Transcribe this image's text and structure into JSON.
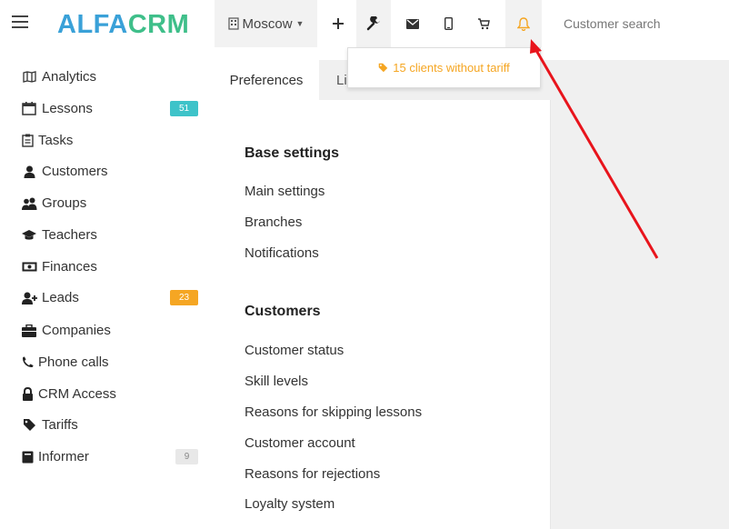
{
  "header": {
    "logo_part1": "ALFA",
    "logo_part2": "CRM",
    "branch": "Moscow",
    "search_placeholder": "Customer search"
  },
  "sidebar": {
    "items": [
      {
        "label": "Analytics",
        "icon": "map-icon"
      },
      {
        "label": "Lessons",
        "icon": "calendar-icon",
        "badge": "51",
        "badge_color": "#3ec3c9"
      },
      {
        "label": "Tasks",
        "icon": "clipboard-icon"
      },
      {
        "label": "Customers",
        "icon": "user-icon"
      },
      {
        "label": "Groups",
        "icon": "users-icon"
      },
      {
        "label": "Teachers",
        "icon": "graduation-cap-icon"
      },
      {
        "label": "Finances",
        "icon": "money-icon"
      },
      {
        "label": "Leads",
        "icon": "user-plus-icon",
        "badge": "23",
        "badge_color": "#f5a623"
      },
      {
        "label": "Companies",
        "icon": "briefcase-icon"
      },
      {
        "label": "Phone calls",
        "icon": "phone-icon"
      },
      {
        "label": "CRM Access",
        "icon": "lock-icon"
      },
      {
        "label": "Tariffs",
        "icon": "tag-icon"
      },
      {
        "label": "Informer",
        "icon": "book-icon",
        "badge": "9",
        "badge_color": "#e8e8e8"
      }
    ]
  },
  "tabs": {
    "active": "Preferences",
    "second": "Li"
  },
  "notification": {
    "text": "15 clients without tariff",
    "color": "#f5a623"
  },
  "settings": {
    "base_title": "Base settings",
    "base_links": [
      "Main settings",
      "Branches",
      "Notifications"
    ],
    "customers_title": "Customers",
    "customers_links": [
      "Customer status",
      "Skill levels",
      "Reasons for skipping lessons",
      "Customer account",
      "Reasons for rejections",
      "Loyalty system"
    ]
  }
}
